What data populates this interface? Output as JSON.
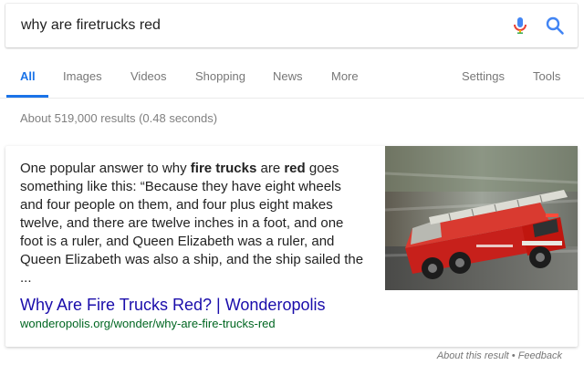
{
  "search": {
    "query": "why are firetrucks red"
  },
  "tabs": [
    {
      "label": "All",
      "active": true
    },
    {
      "label": "Images"
    },
    {
      "label": "Videos"
    },
    {
      "label": "Shopping"
    },
    {
      "label": "News"
    },
    {
      "label": "More"
    },
    {
      "label": "Settings"
    },
    {
      "label": "Tools"
    }
  ],
  "results_stats": "About 519,000 results (0.48 seconds)",
  "featured": {
    "snippet": [
      {
        "t": "One popular answer to why "
      },
      {
        "t": "fire trucks",
        "b": true
      },
      {
        "t": " are "
      },
      {
        "t": "red",
        "b": true
      },
      {
        "t": " goes something like this: “Because they have eight wheels and four people on them, and four plus eight makes twelve, and there are twelve inches in a foot, and one foot is a ruler, and Queen Elizabeth was a ruler, and Queen Elizabeth was also a ship, and the ship sailed the ..."
      }
    ],
    "title": "Why Are Fire Trucks Red? | Wonderopolis",
    "url": "wonderopolis.org/wonder/why-are-fire-trucks-red"
  },
  "footer": {
    "about": "About this result",
    "separator": " • ",
    "feedback": "Feedback"
  },
  "colors": {
    "accent": "#1a73e8",
    "link": "#1a0dab",
    "url": "#006621",
    "mic_blue": "#4285f4",
    "mic_red": "#ea4335",
    "mic_yellow": "#fbbc05",
    "mic_green": "#34a853"
  }
}
